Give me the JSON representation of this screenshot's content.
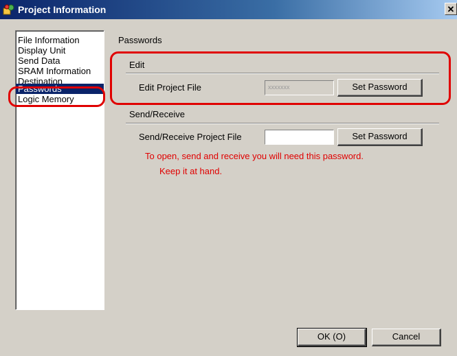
{
  "window": {
    "title": "Project Information",
    "close_glyph": "✕"
  },
  "nav": {
    "items": [
      {
        "label": "File Information"
      },
      {
        "label": "Display Unit"
      },
      {
        "label": "Send Data"
      },
      {
        "label": "SRAM Information"
      },
      {
        "label": "Destination"
      },
      {
        "label": "Passwords"
      },
      {
        "label": "Logic Memory"
      }
    ],
    "selected_index": 5
  },
  "panel": {
    "title": "Passwords",
    "edit": {
      "group_label": "Edit",
      "field_label": "Edit Project File",
      "field_value": "xxxxxxx",
      "button_label": "Set Password"
    },
    "send_receive": {
      "group_label": "Send/Receive",
      "field_label": "Send/Receive Project File",
      "field_value": "",
      "button_label": "Set Password"
    },
    "warning_line1": "To open, send and receive you will need this password.",
    "warning_line2": "Keep it at hand."
  },
  "footer": {
    "ok_label": "OK (O)",
    "cancel_label": "Cancel"
  },
  "colors": {
    "highlight": "#e00000",
    "selection": "#0a246a",
    "face": "#d4d0c8",
    "warning_text": "#e00000"
  },
  "icons": {
    "app": "project-info-icon",
    "close": "close-icon"
  }
}
